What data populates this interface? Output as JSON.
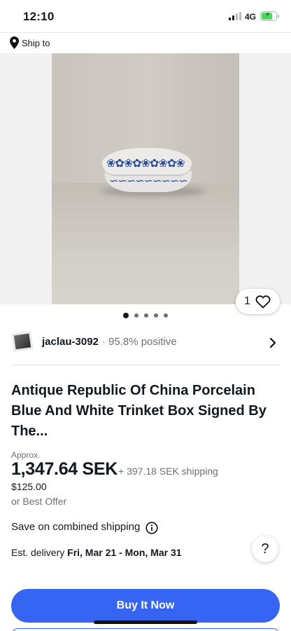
{
  "status_bar": {
    "time": "12:10",
    "network": "4G",
    "icons": [
      "signal-icon",
      "battery-charging-icon"
    ]
  },
  "ship_to": {
    "label": "Ship to",
    "icon": "location-pin-icon"
  },
  "gallery": {
    "watch_count": "1",
    "total_images": 5,
    "active_index": 0
  },
  "seller": {
    "name": "jaclau-3092",
    "separator": "·",
    "feedback": "95.8% positive"
  },
  "item": {
    "title": "Antique Republic Of China Porcelain Blue And White Trinket Box Signed By The...",
    "approx_label": "Approx.",
    "price": "1,347.64 SEK",
    "shipping": "+ 397.18 SEK shipping",
    "original_price": "$125.00",
    "best_offer": "or Best Offer"
  },
  "combined_shipping": {
    "label": "Save on combined shipping"
  },
  "delivery": {
    "prefix": "Est. delivery",
    "dates": "Fri, Mar 21 - Mon, Mar 31"
  },
  "help": {
    "label": "?"
  },
  "actions": {
    "buy_now": "Buy It Now"
  },
  "colors": {
    "accent": "#3665f3",
    "text": "#111820",
    "secondary": "#707070"
  }
}
